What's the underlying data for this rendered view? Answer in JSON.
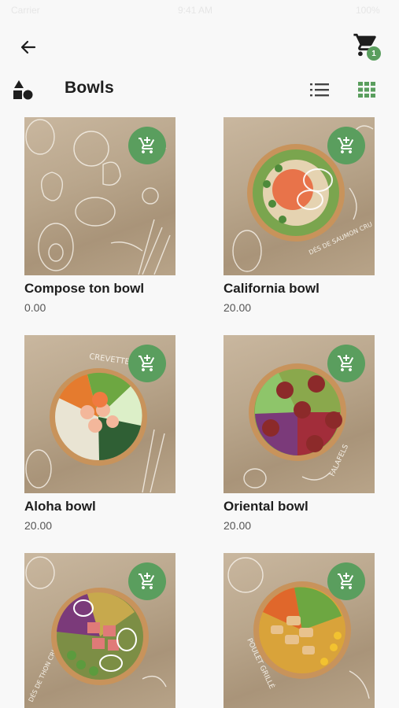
{
  "status_bar": {
    "carrier": "Carrier",
    "time": "9:41 AM",
    "battery": "100%"
  },
  "header": {
    "back_icon": "arrow-left-icon",
    "cart_icon": "shopping-cart-icon",
    "cart_count": "1"
  },
  "category": {
    "icon": "shapes-icon",
    "title": "Bowls",
    "view_modes": [
      "list-icon",
      "grid-icon"
    ],
    "active_view": "grid"
  },
  "colors": {
    "accent": "#5a9e5e",
    "text": "#1e1e1e",
    "price": "#555555",
    "background": "#f8f8f8"
  },
  "products": [
    {
      "name": "Compose ton bowl",
      "price": "0.00",
      "image": "illustrated-vegetables"
    },
    {
      "name": "California bowl",
      "price": "20.00",
      "image": "salmon-bowl",
      "caption": "DÉS DE SAUMON CRU"
    },
    {
      "name": "Aloha bowl",
      "price": "20.00",
      "image": "shrimp-bowl",
      "caption": "CREVETTES"
    },
    {
      "name": "Oriental bowl",
      "price": "20.00",
      "image": "falafel-bowl",
      "caption": "FALAFELS"
    },
    {
      "name": "",
      "price": "",
      "image": "tuna-bowl",
      "caption": "DÉS DE THON CRU"
    },
    {
      "name": "",
      "price": "",
      "image": "chicken-bowl",
      "caption": "POULET GRILLÉ"
    }
  ]
}
